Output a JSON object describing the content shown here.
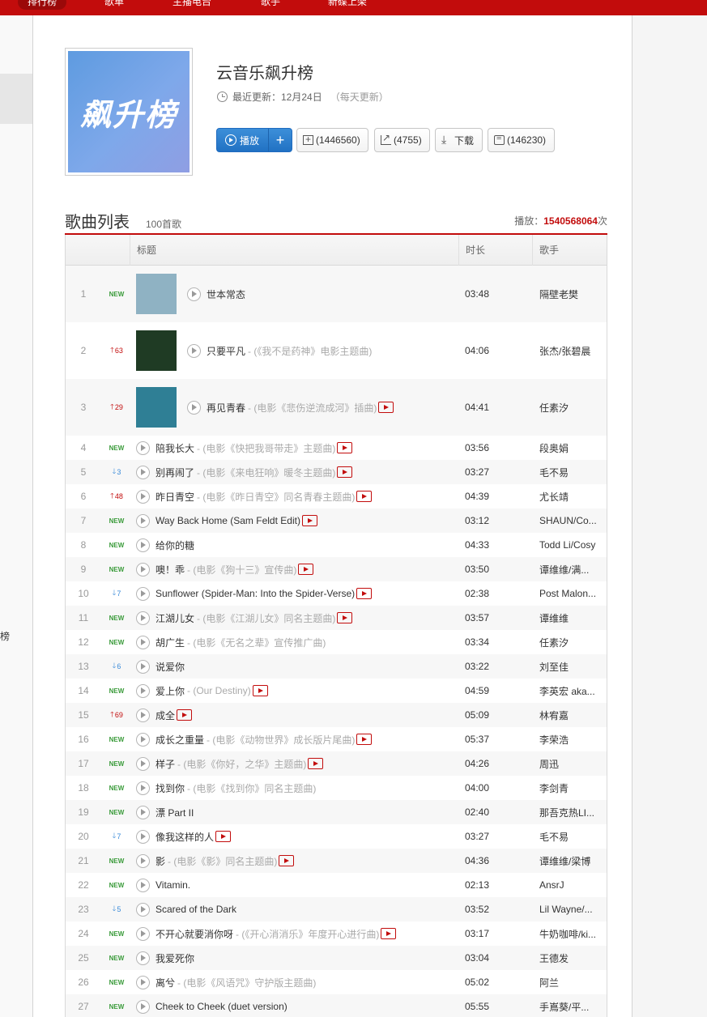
{
  "nav": {
    "items": [
      "排行榜",
      "歌单",
      "主播电台",
      "歌手",
      "新碟上架"
    ]
  },
  "sidebar": {
    "label": "榜"
  },
  "playlist": {
    "title": "云音乐飙升榜",
    "cover_text": "飙升榜",
    "updated": "最近更新：12月24日",
    "frequency": "（每天更新）",
    "play_label": "播放",
    "add_label": "+",
    "fav_label": "(1446560)",
    "share_label": "(4755)",
    "download_label": "下载",
    "comment_label": "(146230)"
  },
  "list": {
    "title": "歌曲列表",
    "count": "100首歌",
    "play_prefix": "播放：",
    "play_count": "1540568064",
    "play_suffix": "次",
    "columns": {
      "title": "标题",
      "duration": "时长",
      "artist": "歌手"
    }
  },
  "colors": {
    "brand": "#c20c0c",
    "play_button": "#2e7fd2",
    "new_badge": "#3a9b3a",
    "down_arrow": "#3b8bd9"
  },
  "songs": [
    {
      "rank": "1",
      "trend": "new",
      "change": "NEW",
      "name": "世本常态",
      "sub": "",
      "mv": false,
      "duration": "03:48",
      "artist": "隔壁老樊",
      "big": true,
      "thumb": "#8fb2c3"
    },
    {
      "rank": "2",
      "trend": "up",
      "change": "63",
      "name": "只要平凡",
      "sub": "- (《我不是药神》电影主题曲)",
      "mv": false,
      "duration": "04:06",
      "artist": "张杰/张碧晨",
      "big": true,
      "thumb": "#1f3b24"
    },
    {
      "rank": "3",
      "trend": "up",
      "change": "29",
      "name": "再见青春",
      "sub": "- (电影《悲伤逆流成河》插曲)",
      "mv": true,
      "duration": "04:41",
      "artist": "任素汐",
      "big": true,
      "thumb": "#2f7f95"
    },
    {
      "rank": "4",
      "trend": "new",
      "change": "NEW",
      "name": "陪我长大",
      "sub": "- (电影《快把我哥带走》主题曲)",
      "mv": true,
      "duration": "03:56",
      "artist": "段奥娟"
    },
    {
      "rank": "5",
      "trend": "down",
      "change": "3",
      "name": "别再闹了",
      "sub": "- (电影《来电狂响》暖冬主题曲)",
      "mv": true,
      "duration": "03:27",
      "artist": "毛不易"
    },
    {
      "rank": "6",
      "trend": "up",
      "change": "48",
      "name": "昨日青空",
      "sub": "- (电影《昨日青空》同名青春主题曲)",
      "mv": true,
      "duration": "04:39",
      "artist": "尤长靖"
    },
    {
      "rank": "7",
      "trend": "new",
      "change": "NEW",
      "name": "Way Back Home (Sam Feldt Edit)",
      "sub": "",
      "mv": true,
      "duration": "03:12",
      "artist": "SHAUN/Co..."
    },
    {
      "rank": "8",
      "trend": "new",
      "change": "NEW",
      "name": "给你的糖",
      "sub": "",
      "mv": false,
      "duration": "04:33",
      "artist": "Todd Li/Cosy"
    },
    {
      "rank": "9",
      "trend": "new",
      "change": "NEW",
      "name": "噢！乖",
      "sub": "- (电影《狗十三》宣传曲)",
      "mv": true,
      "duration": "03:50",
      "artist": "谭维维/满..."
    },
    {
      "rank": "10",
      "trend": "down",
      "change": "7",
      "name": "Sunflower (Spider-Man: Into the Spider-Verse)",
      "sub": "",
      "mv": true,
      "duration": "02:38",
      "artist": "Post Malon..."
    },
    {
      "rank": "11",
      "trend": "new",
      "change": "NEW",
      "name": "江湖儿女",
      "sub": "- (电影《江湖儿女》同名主题曲)",
      "mv": true,
      "duration": "03:57",
      "artist": "谭维维"
    },
    {
      "rank": "12",
      "trend": "new",
      "change": "NEW",
      "name": "胡广生",
      "sub": "- (电影《无名之辈》宣传推广曲)",
      "mv": false,
      "duration": "03:34",
      "artist": "任素汐"
    },
    {
      "rank": "13",
      "trend": "down",
      "change": "6",
      "name": "说爱你",
      "sub": "",
      "mv": false,
      "duration": "03:22",
      "artist": "刘至佳"
    },
    {
      "rank": "14",
      "trend": "new",
      "change": "NEW",
      "name": "爱上你",
      "sub": "- (Our Destiny)",
      "mv": true,
      "duration": "04:59",
      "artist": "李英宏 aka..."
    },
    {
      "rank": "15",
      "trend": "up",
      "change": "69",
      "name": "成全",
      "sub": "",
      "mv": true,
      "duration": "05:09",
      "artist": "林宥嘉"
    },
    {
      "rank": "16",
      "trend": "new",
      "change": "NEW",
      "name": "成长之重量",
      "sub": "- (电影《动物世界》成长版片尾曲)",
      "mv": true,
      "duration": "05:37",
      "artist": "李荣浩"
    },
    {
      "rank": "17",
      "trend": "new",
      "change": "NEW",
      "name": "样子",
      "sub": "- (电影《你好，之华》主题曲)",
      "mv": true,
      "duration": "04:26",
      "artist": "周迅"
    },
    {
      "rank": "18",
      "trend": "new",
      "change": "NEW",
      "name": "找到你",
      "sub": "- (电影《找到你》同名主题曲)",
      "mv": false,
      "duration": "04:00",
      "artist": "李剑青"
    },
    {
      "rank": "19",
      "trend": "new",
      "change": "NEW",
      "name": "漂 Part II",
      "sub": "",
      "mv": false,
      "duration": "02:40",
      "artist": "那吾克热LI..."
    },
    {
      "rank": "20",
      "trend": "down",
      "change": "7",
      "name": "像我这样的人",
      "sub": "",
      "mv": true,
      "duration": "03:27",
      "artist": "毛不易"
    },
    {
      "rank": "21",
      "trend": "new",
      "change": "NEW",
      "name": "影",
      "sub": "- (电影《影》同名主题曲)",
      "mv": true,
      "duration": "04:36",
      "artist": "谭维维/梁博"
    },
    {
      "rank": "22",
      "trend": "new",
      "change": "NEW",
      "name": "Vitamin.",
      "sub": "",
      "mv": false,
      "duration": "02:13",
      "artist": "AnsrJ"
    },
    {
      "rank": "23",
      "trend": "down",
      "change": "5",
      "name": "Scared of the Dark",
      "sub": "",
      "mv": false,
      "duration": "03:52",
      "artist": "Lil Wayne/..."
    },
    {
      "rank": "24",
      "trend": "new",
      "change": "NEW",
      "name": "不开心就要消你呀",
      "sub": "- (《开心消消乐》年度开心进行曲)",
      "mv": true,
      "duration": "03:17",
      "artist": "牛奶咖啡/ki..."
    },
    {
      "rank": "25",
      "trend": "new",
      "change": "NEW",
      "name": "我爱死你",
      "sub": "",
      "mv": false,
      "duration": "03:04",
      "artist": "王德发"
    },
    {
      "rank": "26",
      "trend": "new",
      "change": "NEW",
      "name": "离兮",
      "sub": "- (电影《风语咒》守护版主题曲)",
      "mv": false,
      "duration": "05:02",
      "artist": "阿兰"
    },
    {
      "rank": "27",
      "trend": "new",
      "change": "NEW",
      "name": "Cheek to Cheek (duet version)",
      "sub": "",
      "mv": false,
      "duration": "05:55",
      "artist": "手嶌葵/平..."
    }
  ]
}
